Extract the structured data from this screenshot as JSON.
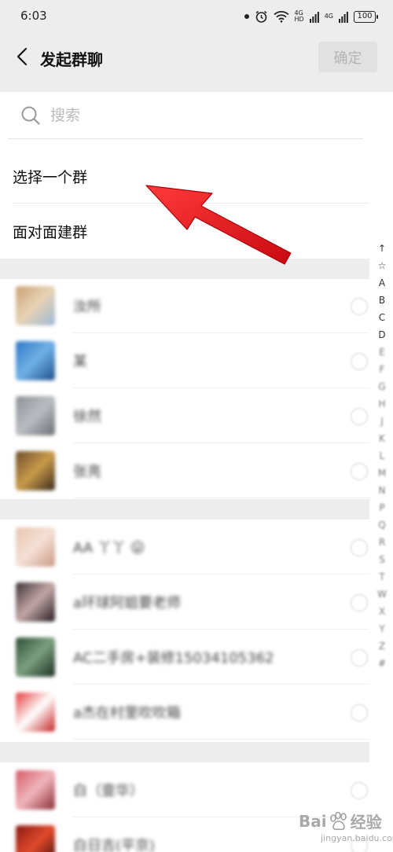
{
  "status_bar": {
    "time": "6:03",
    "net_label_1": "4G",
    "net_label_2": "4G",
    "hd_label": "HD",
    "battery": "100"
  },
  "nav": {
    "title": "发起群聊",
    "confirm_label": "确定"
  },
  "search": {
    "placeholder": "搜索"
  },
  "actions": [
    {
      "label": "选择一个群"
    },
    {
      "label": "面对面建群"
    }
  ],
  "index_bar": {
    "items": [
      "↑",
      "☆",
      "A",
      "B",
      "C",
      "D"
    ]
  },
  "contacts": [
    {
      "name": "汝所",
      "avatar_colors": [
        "#c9a172",
        "#e7d3b5",
        "#9bb8d6"
      ]
    },
    {
      "name": "某",
      "avatar_colors": [
        "#2f78c6",
        "#6fb0e6",
        "#1d4f88"
      ]
    },
    {
      "name": "徐然",
      "avatar_colors": [
        "#8d9096",
        "#b9bcc0",
        "#6c6f74"
      ]
    },
    {
      "name": "张亮",
      "avatar_colors": [
        "#6b4b2a",
        "#c99a4a",
        "#3a2a1c"
      ]
    },
    {
      "name": "AA 丫丫 😛",
      "avatar_colors": [
        "#e8c4b0",
        "#f4e0d4",
        "#c89a85"
      ]
    },
    {
      "name": "a环球阿姐要老师",
      "avatar_colors": [
        "#3b3035",
        "#c4a6a6",
        "#241c20"
      ]
    },
    {
      "name": "AC二手房+装修15034105362",
      "avatar_colors": [
        "#2f4f36",
        "#7aa07e",
        "#1c2e21"
      ]
    },
    {
      "name": "a杰在村里吹吹箱",
      "avatar_colors": [
        "#e43c3c",
        "#ffffff",
        "#c42020"
      ]
    },
    {
      "name": "白（壹华）",
      "avatar_colors": [
        "#d35a66",
        "#f0b6ba",
        "#8b2a36"
      ]
    },
    {
      "name": "白日吉(平京)",
      "avatar_colors": [
        "#8a1a18",
        "#e04a2a",
        "#3a0c0a"
      ]
    }
  ],
  "watermark": {
    "text_left": "Bai",
    "text_right": "经验",
    "sub": "jingyan.baidu.com"
  },
  "colors": {
    "background": "#ededed",
    "annotation_arrow": "#e8141c",
    "confirm_disabled_bg": "#e1e1e1",
    "confirm_disabled_text": "#b4b4b4"
  }
}
